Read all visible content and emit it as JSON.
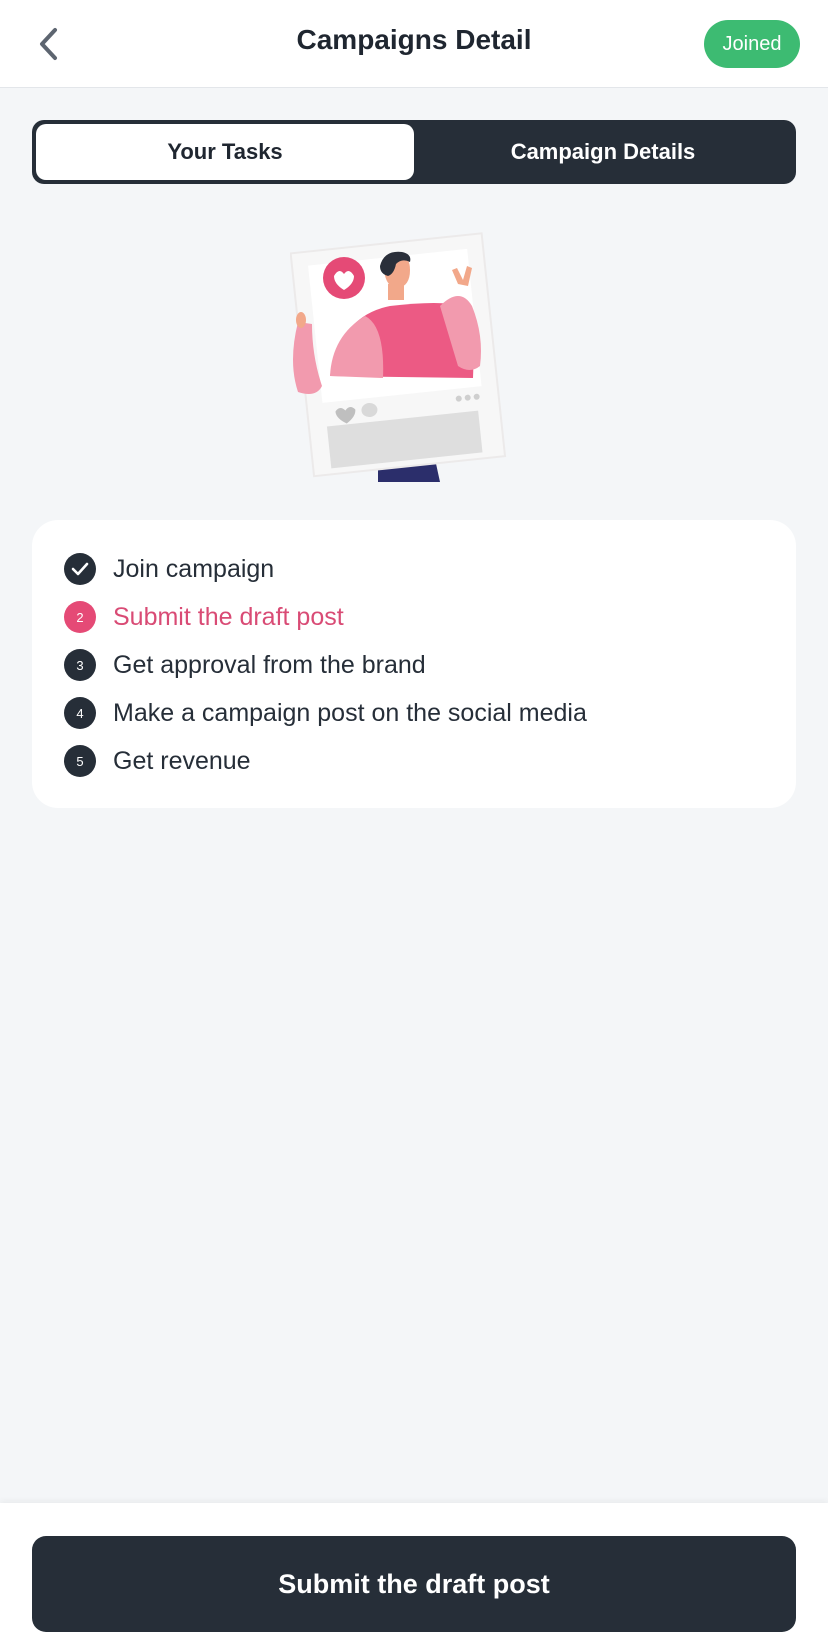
{
  "header": {
    "title": "Campaigns Detail",
    "status_badge": "Joined",
    "back_icon": "chevron-left-icon"
  },
  "tabs": [
    {
      "label": "Your Tasks",
      "active": true
    },
    {
      "label": "Campaign Details",
      "active": false
    }
  ],
  "illustration": {
    "icon": "social-post-illustration"
  },
  "tasks": [
    {
      "number": "",
      "label": "Join campaign",
      "state": "done",
      "icon": "check-icon"
    },
    {
      "number": "2",
      "label": "Submit the draft post",
      "state": "current"
    },
    {
      "number": "3",
      "label": "Get approval from the brand",
      "state": "pending"
    },
    {
      "number": "4",
      "label": "Make a campaign post on the social media",
      "state": "pending"
    },
    {
      "number": "5",
      "label": "Get revenue",
      "state": "pending"
    }
  ],
  "footer": {
    "submit_label": "Submit the draft post"
  },
  "colors": {
    "accent": "#e54a76",
    "dark": "#262e38",
    "success": "#3dbb72",
    "background": "#f4f6f8"
  }
}
